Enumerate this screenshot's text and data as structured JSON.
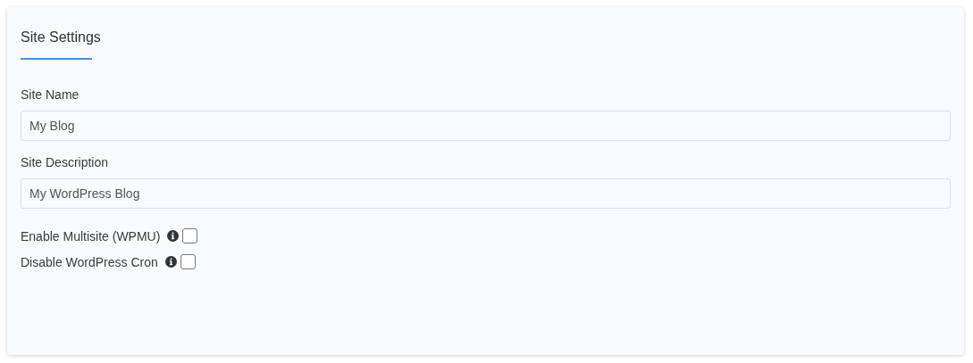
{
  "card": {
    "title": "Site Settings"
  },
  "fields": [
    {
      "label": "Site Name",
      "value": "My Blog"
    },
    {
      "label": "Site Description",
      "value": "My WordPress Blog"
    }
  ],
  "options": [
    {
      "label": "Enable Multisite (WPMU)",
      "checked": false
    },
    {
      "label": "Disable WordPress Cron",
      "checked": false
    }
  ]
}
